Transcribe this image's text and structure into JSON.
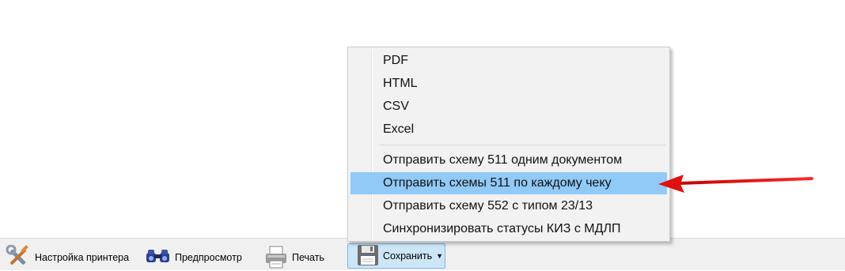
{
  "toolbar": {
    "printer_settings_label": "Настройка принтера",
    "preview_label": "Предпросмотр",
    "print_label": "Печать",
    "save_label": "Сохранить",
    "save_dropdown_icon": "chevron-down-icon"
  },
  "menu": {
    "items": [
      {
        "label": "PDF"
      },
      {
        "label": "HTML"
      },
      {
        "label": "CSV"
      },
      {
        "label": "Excel"
      },
      {
        "label": "Отправить схему 511 одним документом"
      },
      {
        "label": "Отправить схемы 511 по каждому чеку",
        "highlighted": true
      },
      {
        "label": "Отправить схему 552 с типом 23/13"
      },
      {
        "label": "Синхронизировать статусы КИЗ с МДЛП"
      }
    ]
  },
  "colors": {
    "highlight": "#91c9f7",
    "annotation_arrow": "#e01010",
    "save_button_bg": "#cde6f7"
  }
}
